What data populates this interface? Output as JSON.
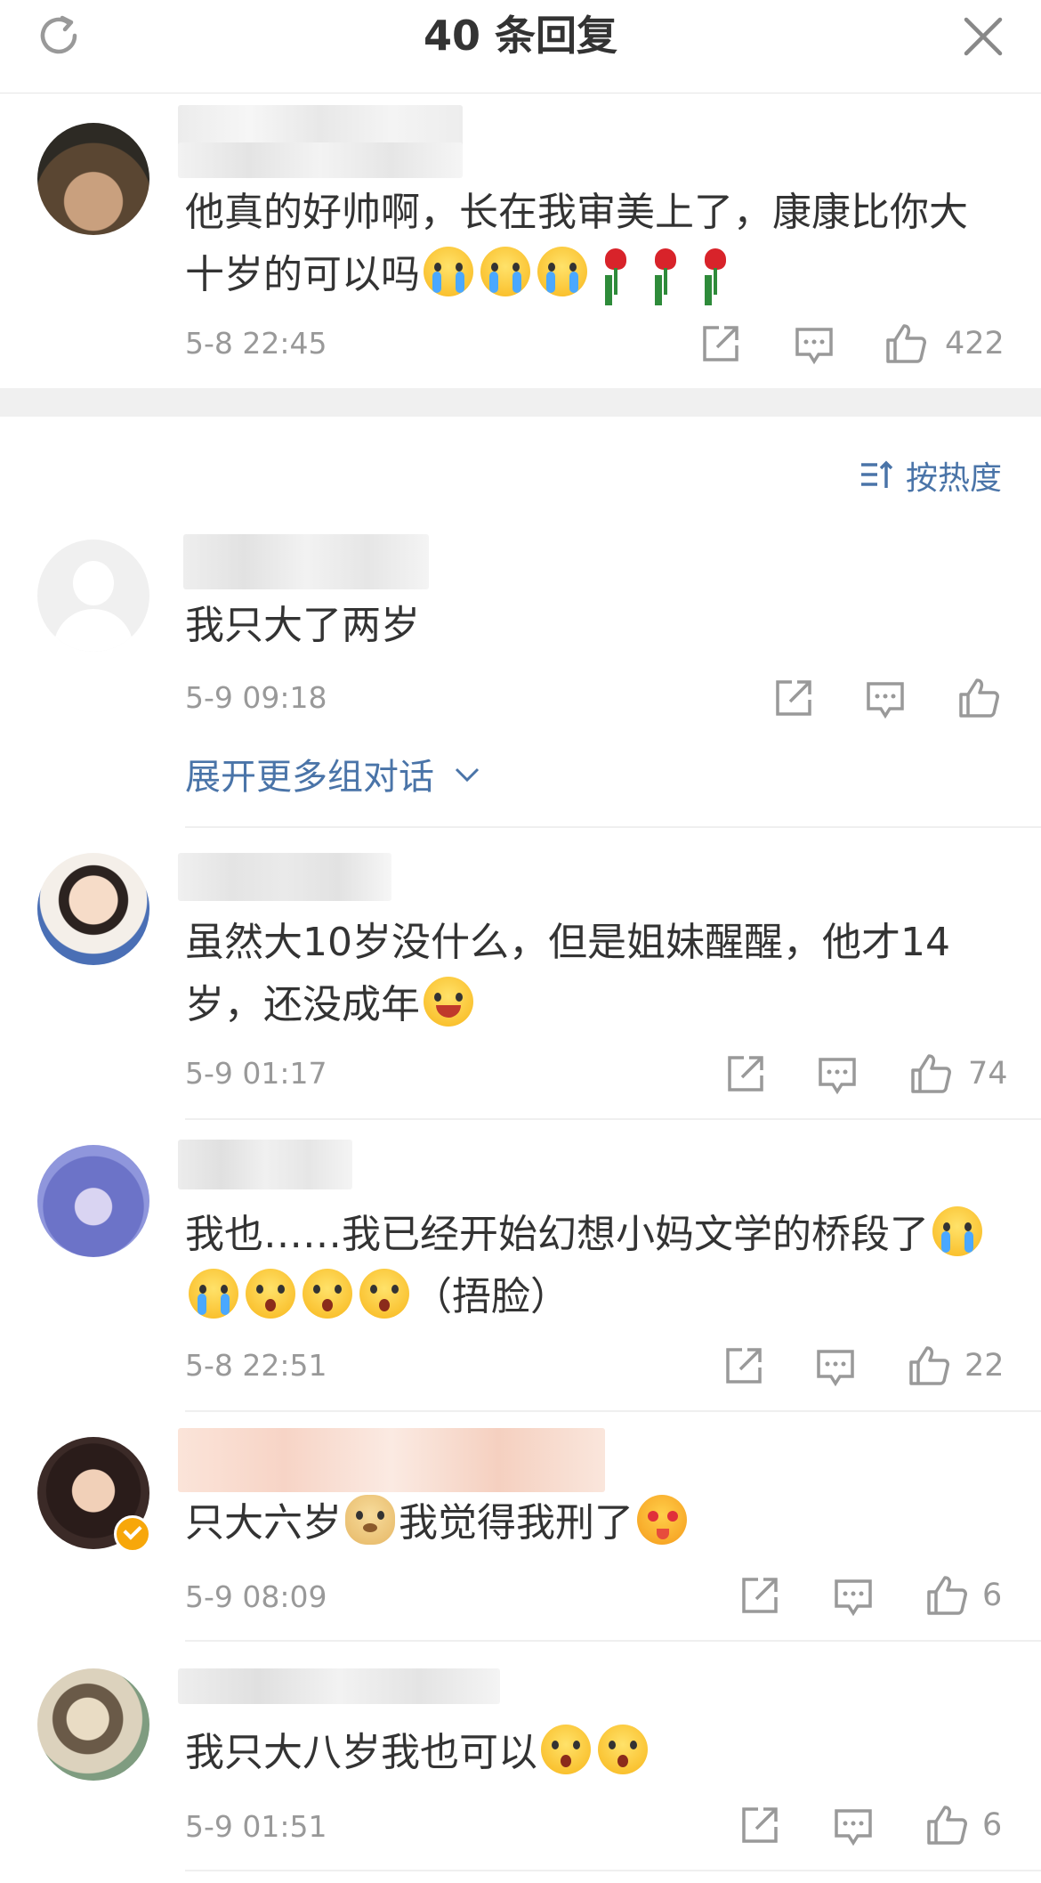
{
  "header": {
    "title": "40 条回复"
  },
  "top_comment": {
    "text_parts": [
      "他真的好帅啊，长在我审美上了，康康比你大十岁的可以吗"
    ],
    "time": "5-8 22:45",
    "likes": "422"
  },
  "sort": {
    "label": "按热度"
  },
  "expand_link": "展开更多组对话",
  "comments": [
    {
      "text": "我只大了两岁",
      "time": "5-9 09:18",
      "likes": ""
    },
    {
      "text": "虽然大10岁没什么，但是姐妹醒醒，他才14岁，还没成年",
      "time": "5-9 01:17",
      "likes": "74"
    },
    {
      "text": "我也……我已经开始幻想小妈文学的桥段了",
      "text_tail": "（捂脸）",
      "time": "5-8 22:51",
      "likes": "22"
    },
    {
      "text_a": "只大六岁",
      "text_b": "我觉得我刑了",
      "time": "5-9 08:09",
      "likes": "6"
    },
    {
      "text": "我只大八岁我也可以",
      "time": "5-9 01:51",
      "likes": "6"
    }
  ],
  "colors": {
    "link": "#4a74a8",
    "meta": "#999999",
    "text": "#333333",
    "band": "#f0f0f0"
  }
}
